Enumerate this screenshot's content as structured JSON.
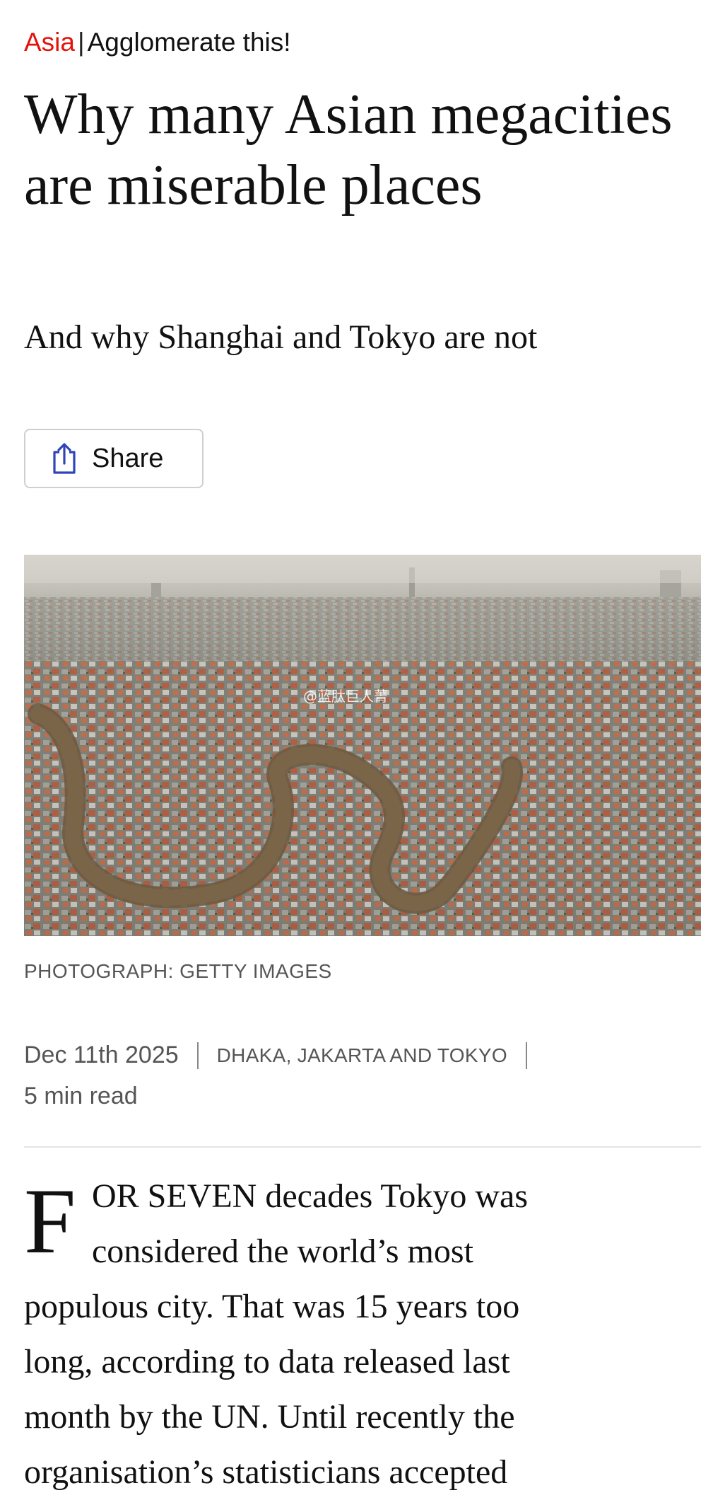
{
  "rubric": {
    "section": "Asia",
    "divider": "|",
    "fly_title": "Agglomerate this!"
  },
  "headline": "Why many Asian megacities are miserable places",
  "standfirst": "And why Shanghai and Tokyo are not",
  "share": {
    "label": "Share",
    "icon": "share-icon"
  },
  "image": {
    "watermark": "@蓝肽巨人菁",
    "credit": "PHOTOGRAPH: GETTY IMAGES"
  },
  "meta": {
    "date": "Dec 11th 2025",
    "dateline": "DHAKA, JAKARTA AND TOKYO",
    "read_time": "5 min read"
  },
  "body": {
    "drop_cap": "F",
    "lines": [
      {
        "smallcaps": "OR SEVEN",
        "text": " decades Tokyo was"
      },
      {
        "text": "considered the world’s most"
      },
      {
        "text": "populous city. That was 15 years too"
      },
      {
        "text": "long, according to data released last"
      },
      {
        "before": "month by the ",
        "smallcaps": "UN",
        "after": ". Until recently the"
      },
      {
        "text": "organisation’s statisticians accepted"
      }
    ]
  },
  "colors": {
    "section_red": "#e3120b",
    "share_icon_blue": "#2e45b8",
    "text": "#111111",
    "meta_grey": "#555555"
  }
}
